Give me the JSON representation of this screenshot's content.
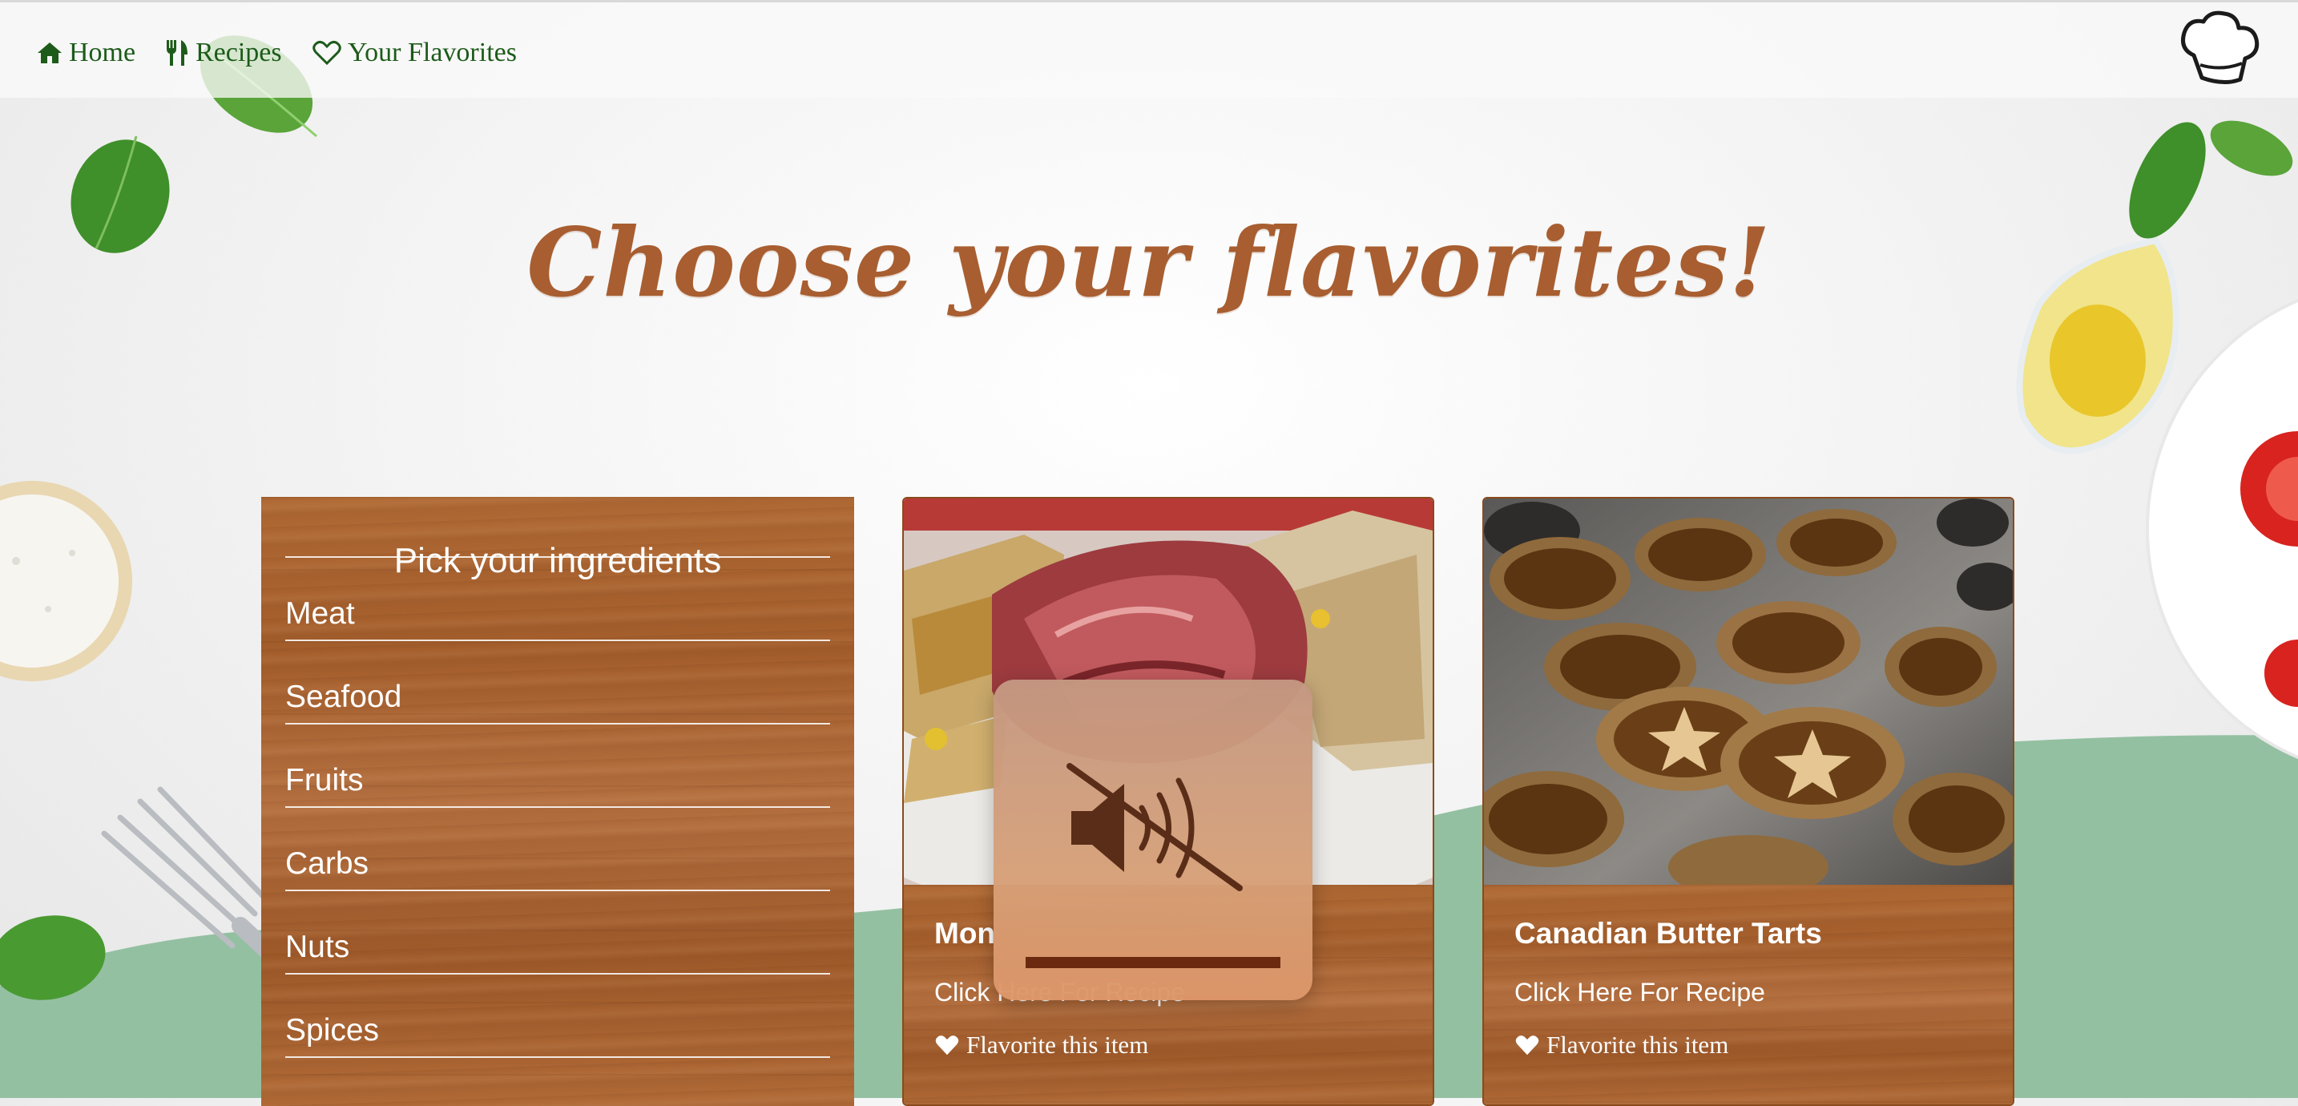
{
  "nav": {
    "items": [
      {
        "label": "Home",
        "icon": "home-icon"
      },
      {
        "label": "Recipes",
        "icon": "fork-knife-icon"
      },
      {
        "label": "Your Flavorites",
        "icon": "heart-outline-icon"
      }
    ],
    "logo_icon": "chef-hat-icon"
  },
  "page": {
    "title": "Choose your flavorites!"
  },
  "ingredients": {
    "title": "Pick your ingredients",
    "items": [
      "Meat",
      "Seafood",
      "Fruits",
      "Carbs",
      "Nuts",
      "Spices"
    ]
  },
  "cards": [
    {
      "title": "Mon",
      "link": "Click Here For Recipe",
      "favorite": "Flavorite this item",
      "image": "smoked-meat-sandwich"
    },
    {
      "title": "Canadian Butter Tarts",
      "link": "Click Here For Recipe",
      "favorite": "Flavorite this item",
      "image": "butter-tarts"
    }
  ],
  "overlay": {
    "icon": "speaker-muted-icon",
    "volume_level": 1.0
  },
  "colors": {
    "nav_text": "#1d5b1a",
    "title": "#a85e30",
    "wave": "#94c0a2",
    "wood": "#a85f2d"
  }
}
